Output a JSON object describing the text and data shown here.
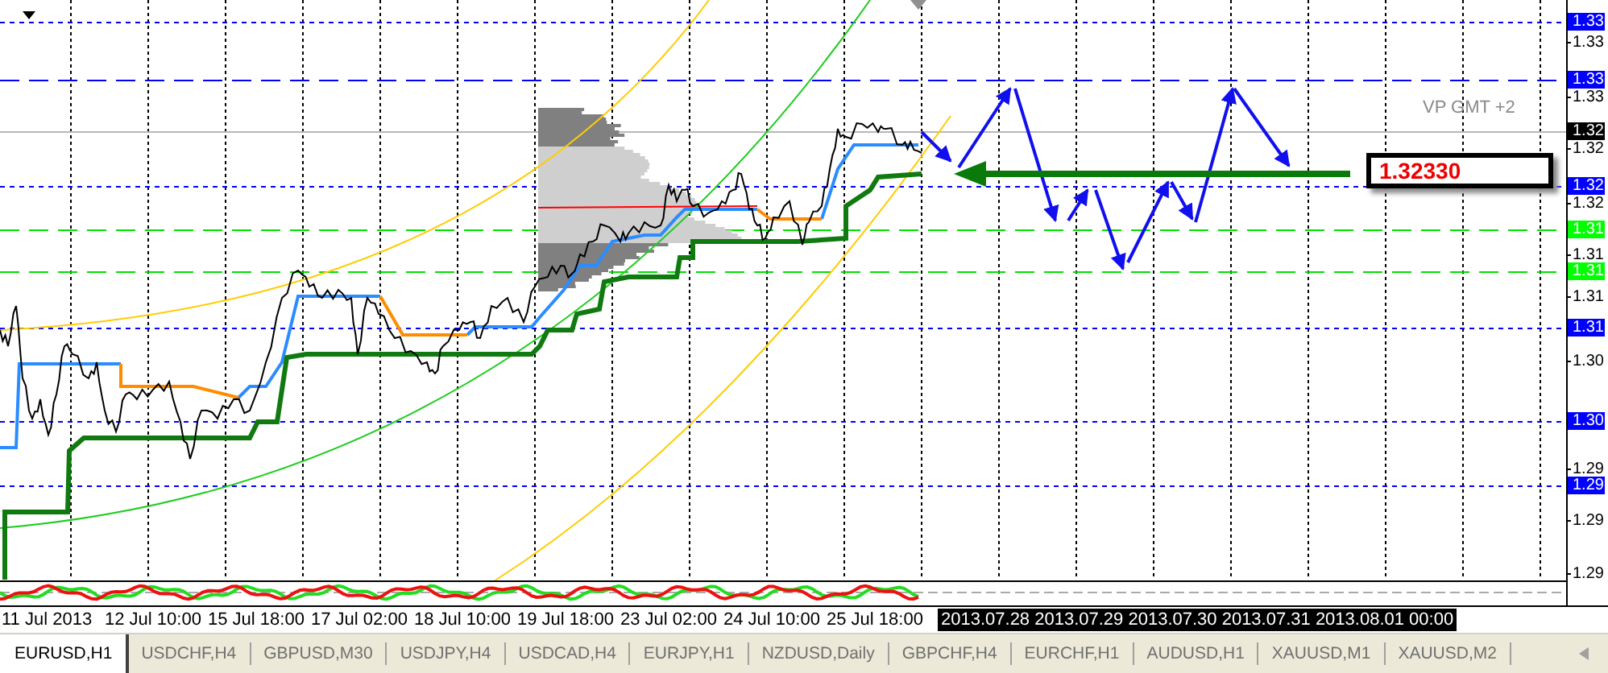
{
  "chart": {
    "profile_label": "VP GMT +2",
    "price_label": "1.32330"
  },
  "price_axis": {
    "labels": [
      {
        "text": "1.33",
        "kind": "marker",
        "color": "#0000ff"
      },
      {
        "text": "1.33",
        "kind": "tick"
      },
      {
        "text": "1.33",
        "kind": "marker",
        "color": "#0000ff"
      },
      {
        "text": "1.33",
        "kind": "tick"
      },
      {
        "text": "1.32",
        "kind": "marker",
        "color": "#000000"
      },
      {
        "text": "1.32",
        "kind": "tick"
      },
      {
        "text": "1.32",
        "kind": "marker",
        "color": "#0000ff"
      },
      {
        "text": "1.32",
        "kind": "tick"
      },
      {
        "text": "1.31",
        "kind": "marker",
        "color": "#00ff00"
      },
      {
        "text": "1.31",
        "kind": "tick"
      },
      {
        "text": "1.31",
        "kind": "marker",
        "color": "#00ff00"
      },
      {
        "text": "1.31",
        "kind": "tick"
      },
      {
        "text": "1.31",
        "kind": "marker",
        "color": "#0000ff"
      },
      {
        "text": "1.30",
        "kind": "tick"
      },
      {
        "text": "1.30",
        "kind": "marker",
        "color": "#0000ff"
      },
      {
        "text": "1.29",
        "kind": "tick"
      },
      {
        "text": "1.29",
        "kind": "marker",
        "color": "#0000ff"
      },
      {
        "text": "1.29",
        "kind": "tick"
      },
      {
        "text": "1.29",
        "kind": "tick"
      }
    ]
  },
  "time_axis": {
    "labels": [
      "11 Jul 2013",
      "12 Jul 10:00",
      "15 Jul 18:00",
      "17 Jul 02:00",
      "18 Jul 10:00",
      "19 Jul 18:00",
      "23 Jul 02:00",
      "24 Jul 10:00",
      "25 Jul 18:00"
    ],
    "cursor_label": "2013.07.28 2013.07.29 2013.07.30 2013.07.31 2013.08.01 00:00"
  },
  "tabs": [
    {
      "label": "EURUSD,H1",
      "selected": true
    },
    {
      "label": "USDCHF,H4",
      "selected": false
    },
    {
      "label": "GBPUSD,M30",
      "selected": false
    },
    {
      "label": "USDJPY,H4",
      "selected": false
    },
    {
      "label": "USDCAD,H4",
      "selected": false
    },
    {
      "label": "EURJPY,H1",
      "selected": false
    },
    {
      "label": "NZDUSD,Daily",
      "selected": false
    },
    {
      "label": "GBPCHF,H4",
      "selected": false
    },
    {
      "label": "EURCHF,H1",
      "selected": false
    },
    {
      "label": "AUDUSD,H1",
      "selected": false
    },
    {
      "label": "XAUUSD,M1",
      "selected": false
    },
    {
      "label": "XAUUSD,M2",
      "selected": false
    }
  ]
}
